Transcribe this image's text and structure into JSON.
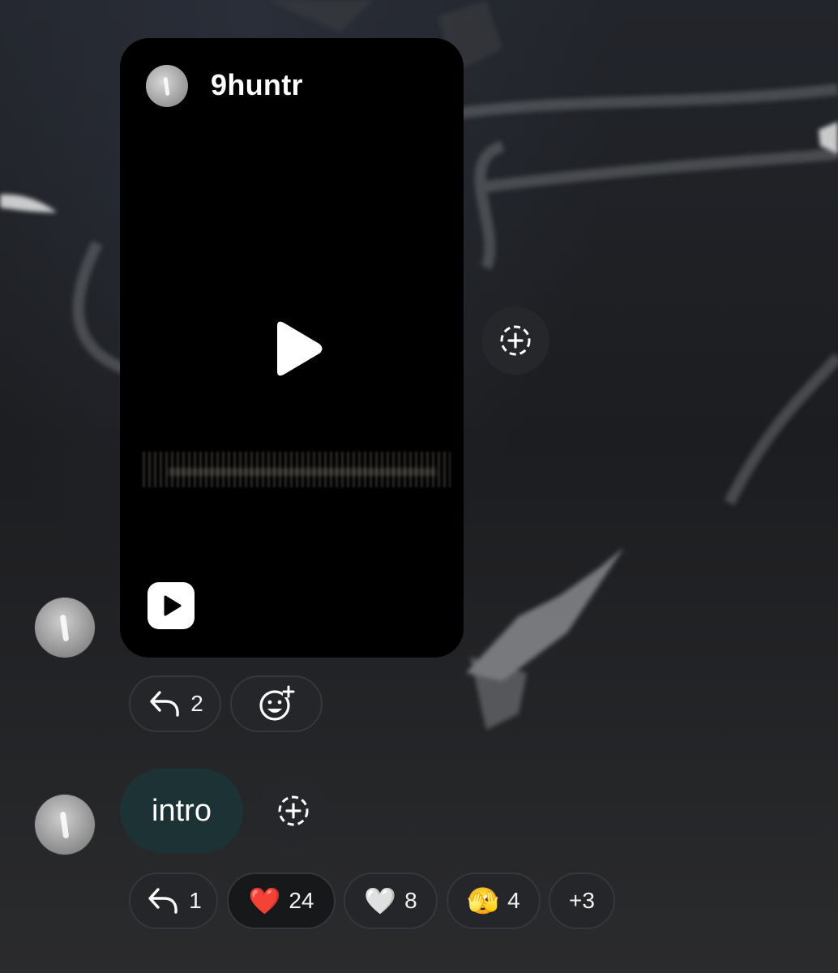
{
  "post": {
    "username": "9huntr",
    "icons": {
      "avatar": "user-avatar",
      "play": "play-icon",
      "reels": "reels-icon"
    }
  },
  "add_reaction_icon": "add-story-dashed-plus-icon",
  "post_actions": {
    "reply_count": "2",
    "emoji_add_icon": "add-emoji-icon"
  },
  "message": {
    "text": "intro",
    "colors": {
      "bubble": "#1c3234"
    }
  },
  "message_actions": {
    "reply_count": "1",
    "reactions": [
      {
        "emoji": "❤️",
        "icon": "red-heart-emoji",
        "count": "24"
      },
      {
        "emoji": "🤍",
        "icon": "white-heart-emoji",
        "count": "8"
      },
      {
        "emoji": "🫣",
        "icon": "peeking-face-emoji",
        "count": "4"
      }
    ],
    "more_label": "+3"
  }
}
